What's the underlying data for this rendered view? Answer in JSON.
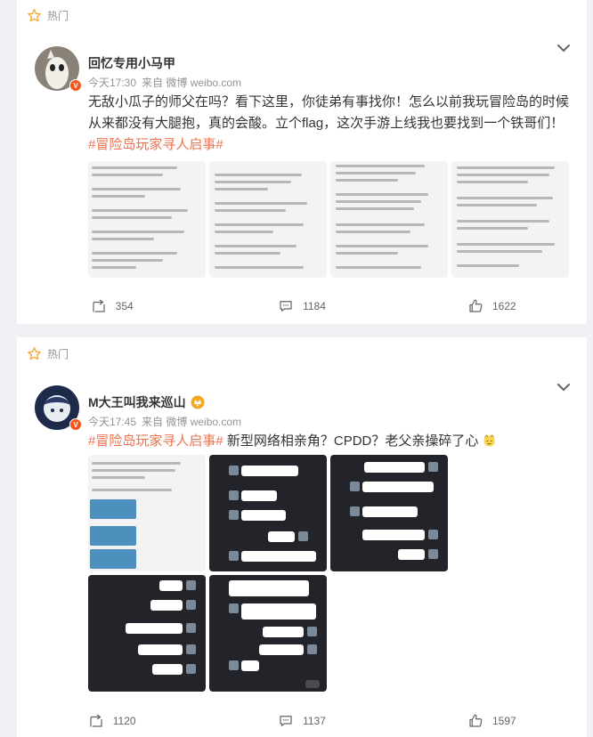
{
  "feed": {
    "hot_label": "热门",
    "posts": [
      {
        "username": "回忆专用小马甲",
        "time": "今天17:30",
        "source": "来自 微博 weibo.com",
        "text": "无敌小瓜子的师父在吗？看下这里，你徒弟有事找你！怎么以前我玩冒险岛的时候从来都没有大腿抱，真的会酸。立个flag，这次手游上线我也要找到一个铁哥们！",
        "hashtag": "#冒险岛玩家寻人启事#",
        "reposts": "354",
        "comments": "1184",
        "likes": "1622"
      },
      {
        "username": "M大王叫我来巡山",
        "time": "今天17:45",
        "source": "来自 微博 weibo.com",
        "hashtag": "#冒险岛玩家寻人启事#",
        "text": " 新型网络相亲角？CPDD？老父亲操碎了心",
        "reposts": "1120",
        "comments": "1137",
        "likes": "1597"
      }
    ]
  },
  "colors": {
    "accent": "#eb7350",
    "verified": "#f7551b",
    "muted": "#939393"
  },
  "icons": [
    "star-icon",
    "chevron-down-icon",
    "verified-badge",
    "repost-icon",
    "comment-icon",
    "like-icon",
    "emoji-icon"
  ]
}
